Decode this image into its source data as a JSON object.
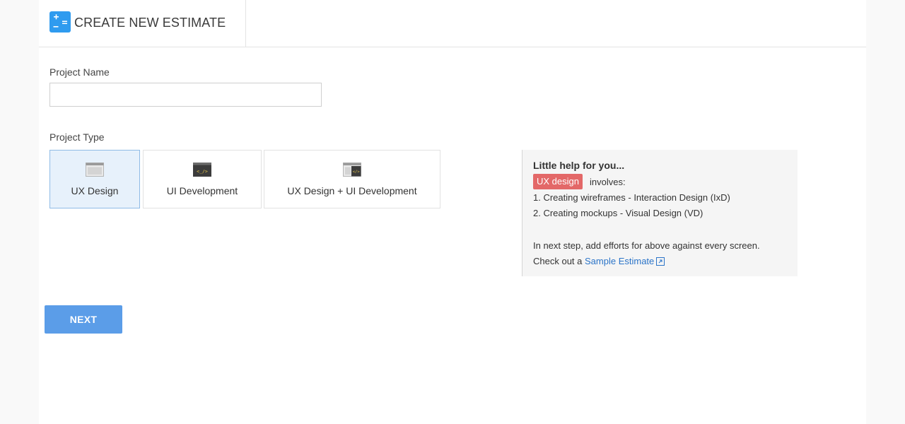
{
  "header": {
    "title": "CREATE NEW ESTIMATE",
    "icon": "calculator-icon",
    "icon_color": "#2f9bef"
  },
  "form": {
    "project_name_label": "Project Name",
    "project_name_value": "",
    "project_name_placeholder": "",
    "project_type_label": "Project Type",
    "project_types": [
      {
        "label": "UX Design",
        "icon": "browser-window-icon",
        "selected": true
      },
      {
        "label": "UI Development",
        "icon": "code-terminal-icon",
        "selected": false
      },
      {
        "label": "UX Design + UI Development",
        "icon": "browser-code-icon",
        "selected": false
      }
    ],
    "selected_color": "#e7f1fb"
  },
  "help": {
    "title": "Little help for you...",
    "badge": "UX design",
    "badge_color": "#e36868",
    "involves": "involves:",
    "items": [
      "1. Creating wireframes - Interaction Design (IxD)",
      "2. Creating mockups - Visual Design (VD)"
    ],
    "note": "In next step, add efforts for above against every screen.",
    "checkout_prefix": "Check out a",
    "link_text": "Sample Estimate",
    "link_icon": "external-link-icon"
  },
  "actions": {
    "next_label": "NEXT",
    "next_color": "#5b9de8"
  }
}
